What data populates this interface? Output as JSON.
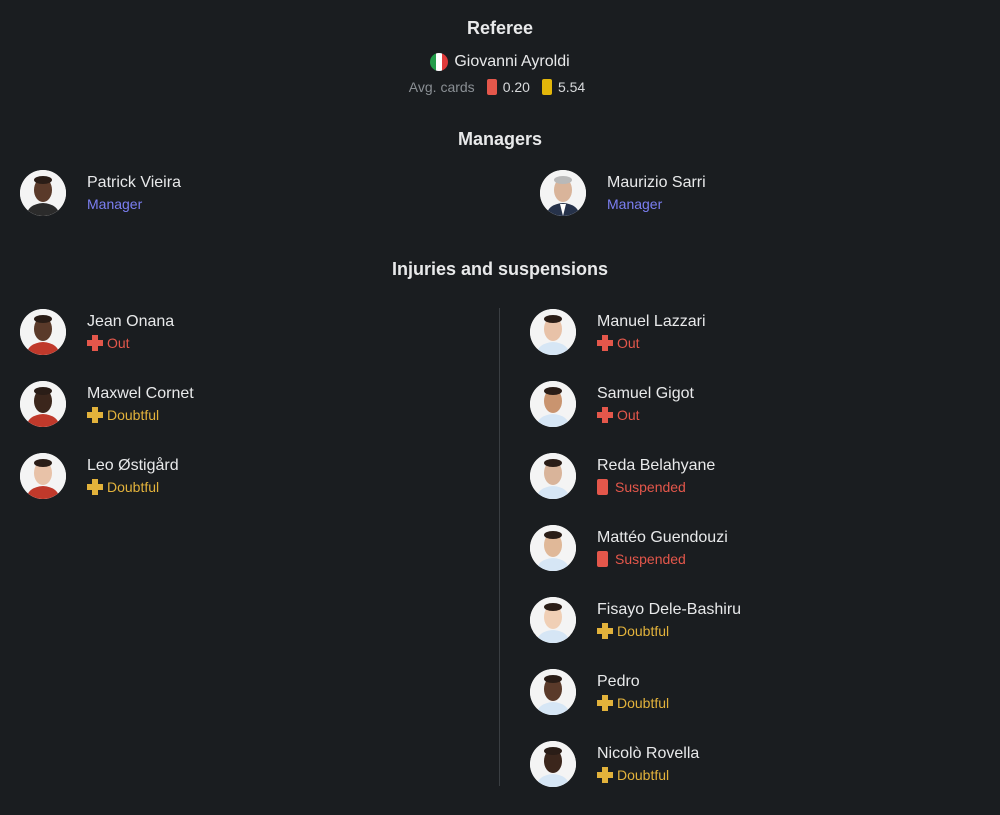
{
  "referee": {
    "title": "Referee",
    "name": "Giovanni Ayroldi",
    "flag_colors": [
      "#229c4a",
      "#ffffff",
      "#e03a3a"
    ],
    "avg_label": "Avg. cards",
    "red_avg": "0.20",
    "yellow_avg": "5.54",
    "red_color": "#e4574b",
    "yellow_color": "#e2b60a"
  },
  "managers": {
    "title": "Managers",
    "home": {
      "name": "Patrick Vieira",
      "role": "Manager"
    },
    "away": {
      "name": "Maurizio Sarri",
      "role": "Manager"
    }
  },
  "injuries": {
    "title": "Injuries and suspensions",
    "home": [
      {
        "name": "Jean Onana",
        "status": "Out",
        "type": "out"
      },
      {
        "name": "Maxwel Cornet",
        "status": "Doubtful",
        "type": "doubtful"
      },
      {
        "name": "Leo Østigård",
        "status": "Doubtful",
        "type": "doubtful"
      }
    ],
    "away": [
      {
        "name": "Manuel Lazzari",
        "status": "Out",
        "type": "out"
      },
      {
        "name": "Samuel Gigot",
        "status": "Out",
        "type": "out"
      },
      {
        "name": "Reda Belahyane",
        "status": "Suspended",
        "type": "suspended"
      },
      {
        "name": "Mattéo Guendouzi",
        "status": "Suspended",
        "type": "suspended"
      },
      {
        "name": "Fisayo Dele-Bashiru",
        "status": "Doubtful",
        "type": "doubtful"
      },
      {
        "name": "Pedro",
        "status": "Doubtful",
        "type": "doubtful"
      },
      {
        "name": "Nicolò Rovella",
        "status": "Doubtful",
        "type": "doubtful"
      }
    ]
  }
}
